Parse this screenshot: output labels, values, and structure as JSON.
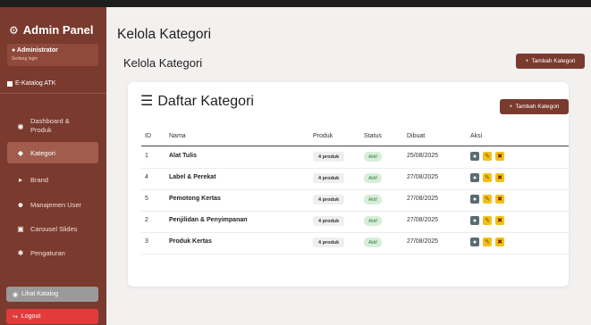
{
  "sidebar": {
    "title": "Admin Panel",
    "user": {
      "name": "Administrator",
      "status": "Sedang login"
    },
    "ekatalog": "E-Katalog ATK",
    "items": [
      {
        "label_line1": "Dashboard &",
        "label_line2": "Produk",
        "icon": "dashboard-icon"
      },
      {
        "label": "Kategori",
        "icon": "layers-icon",
        "active": true
      },
      {
        "label": "Brand",
        "icon": "tag-icon"
      },
      {
        "label": "Manajemen User",
        "icon": "users-icon"
      },
      {
        "label": "Carousel Slides",
        "icon": "images-icon"
      },
      {
        "label": "Pengaturan",
        "icon": "gear-icon"
      }
    ],
    "lihat_katalog": "Lihat Katalog",
    "logout": "Logout"
  },
  "main": {
    "page_title": "Kelola Kategori",
    "section_title": "Kelola Kategori",
    "add_button": "Tambah Kategori"
  },
  "card": {
    "title": "Daftar Kategori",
    "add_button": "Tambah Kategori",
    "columns": [
      "ID",
      "Nama",
      "Produk",
      "Status",
      "Dibuat",
      "Aksi"
    ],
    "rows": [
      {
        "id": "1",
        "name": "Alat Tulis",
        "produk": "4 produk",
        "status": "Aktif",
        "dibuat": "25/08/2025"
      },
      {
        "id": "4",
        "name": "Label & Perekat",
        "produk": "4 produk",
        "status": "Aktif",
        "dibuat": "27/08/2025"
      },
      {
        "id": "5",
        "name": "Pemotong Kertas",
        "produk": "4 produk",
        "status": "Aktif",
        "dibuat": "27/08/2025"
      },
      {
        "id": "2",
        "name": "Penjilidan & Penyimpanan",
        "produk": "4 produk",
        "status": "Aktif",
        "dibuat": "27/08/2025"
      },
      {
        "id": "3",
        "name": "Produk Kertas",
        "produk": "4 produk",
        "status": "Aktif",
        "dibuat": "27/08/2025"
      }
    ]
  },
  "colors": {
    "sidebar": "#7a3a2e",
    "primary_button": "#7a3a2e",
    "logout": "#e23b3b",
    "status_badge": "#d7eed9",
    "edit_action": "#f3c01b"
  }
}
